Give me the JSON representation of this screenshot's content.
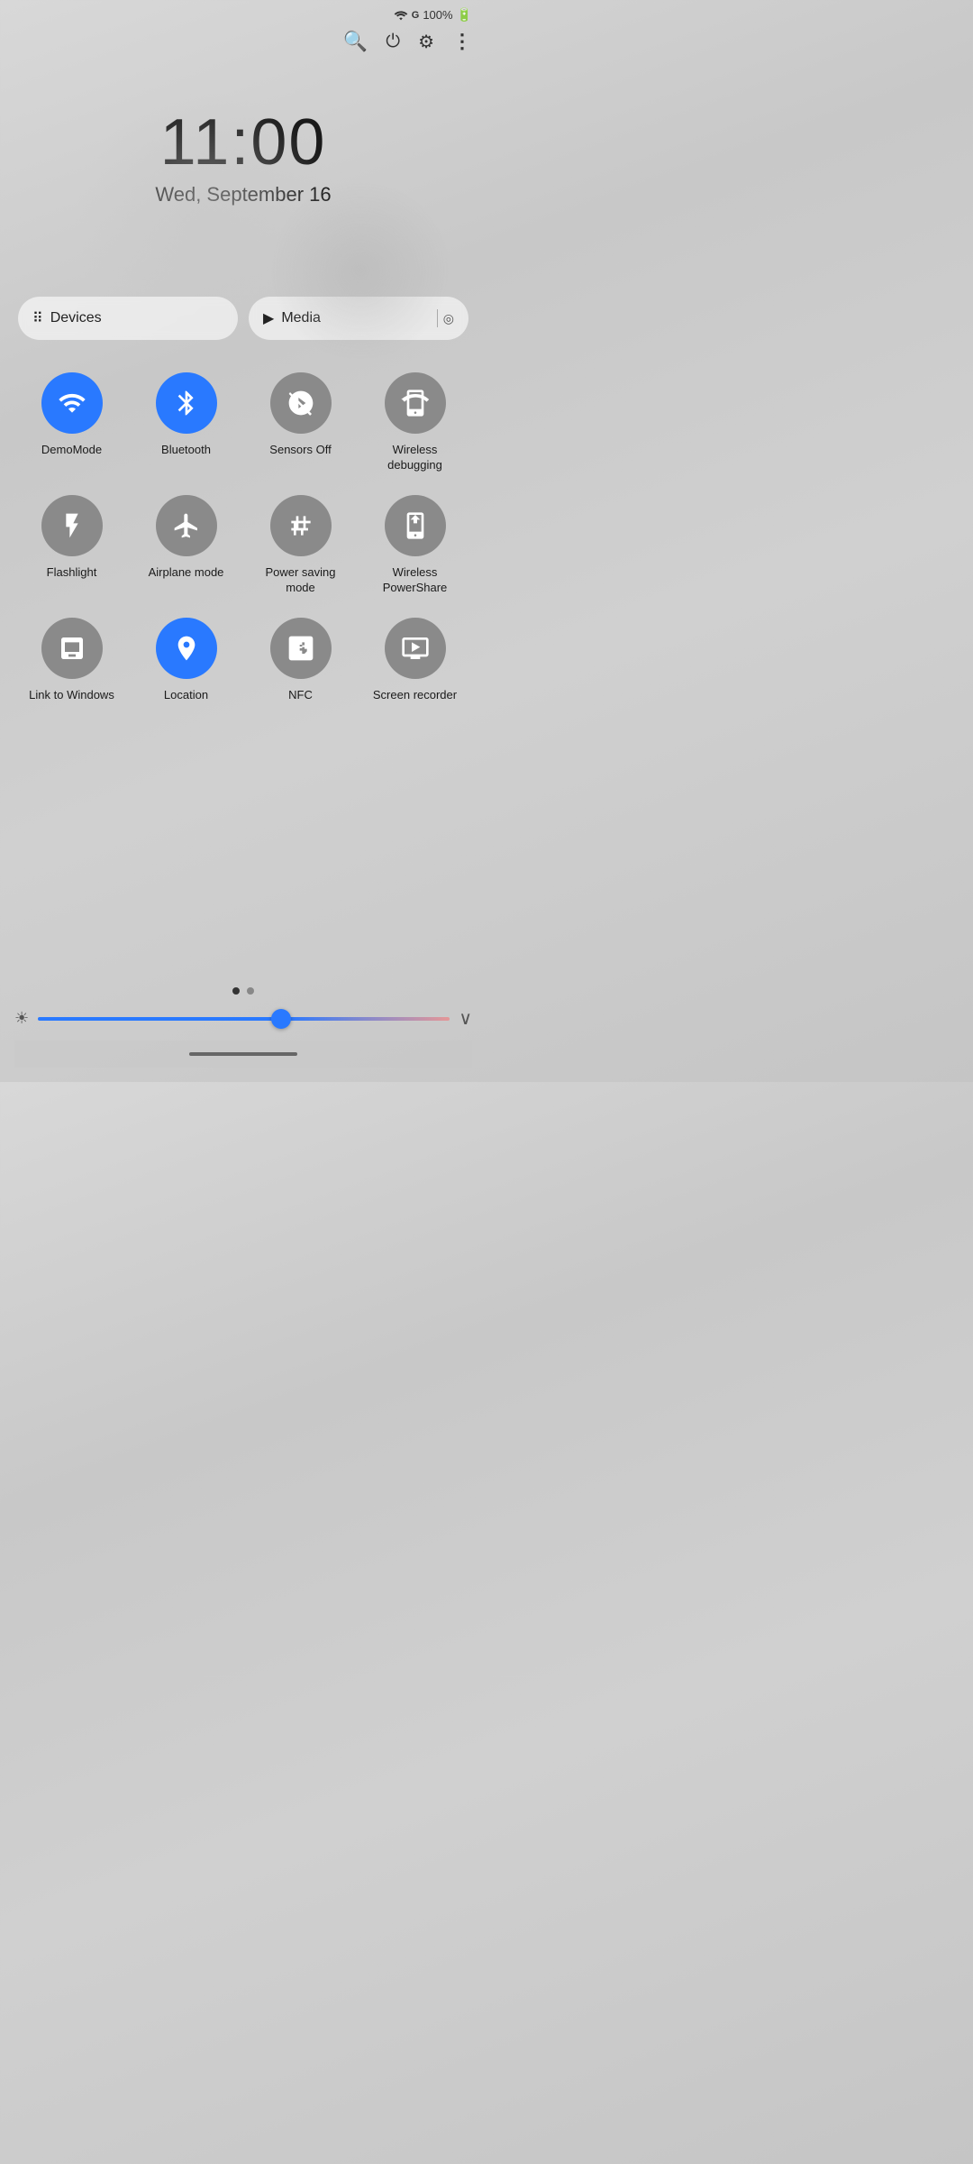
{
  "statusBar": {
    "battery": "100%",
    "batteryIcon": "🔋"
  },
  "quickControls": {
    "searchIcon": "🔍",
    "powerIcon": "⏻",
    "settingsIcon": "⚙",
    "moreIcon": "⋮"
  },
  "clock": {
    "time": "11:00",
    "date": "Wed, September 16"
  },
  "shortcuts": {
    "devicesLabel": "Devices",
    "mediaLabel": "Media"
  },
  "tiles": {
    "row1": [
      {
        "id": "demomode",
        "label": "DemoMode",
        "active": true
      },
      {
        "id": "bluetooth",
        "label": "Bluetooth",
        "active": true
      },
      {
        "id": "sensorsoff",
        "label": "Sensors Off",
        "active": false
      },
      {
        "id": "wirelessdebugging",
        "label": "Wireless debugging",
        "active": false
      }
    ],
    "row2": [
      {
        "id": "flashlight",
        "label": "Flashlight",
        "active": false
      },
      {
        "id": "airplanemode",
        "label": "Airplane mode",
        "active": false
      },
      {
        "id": "powersaving",
        "label": "Power saving mode",
        "active": false
      },
      {
        "id": "wirelesspowershare",
        "label": "Wireless PowerShare",
        "active": false
      }
    ],
    "row3": [
      {
        "id": "linktowindows",
        "label": "Link to Windows",
        "active": false
      },
      {
        "id": "location",
        "label": "Location",
        "active": true
      },
      {
        "id": "nfc",
        "label": "NFC",
        "active": false
      },
      {
        "id": "screenrecorder",
        "label": "Screen recorder",
        "active": false
      }
    ]
  },
  "pageDots": [
    {
      "active": true
    },
    {
      "active": false
    }
  ],
  "brightness": {
    "value": 60
  }
}
